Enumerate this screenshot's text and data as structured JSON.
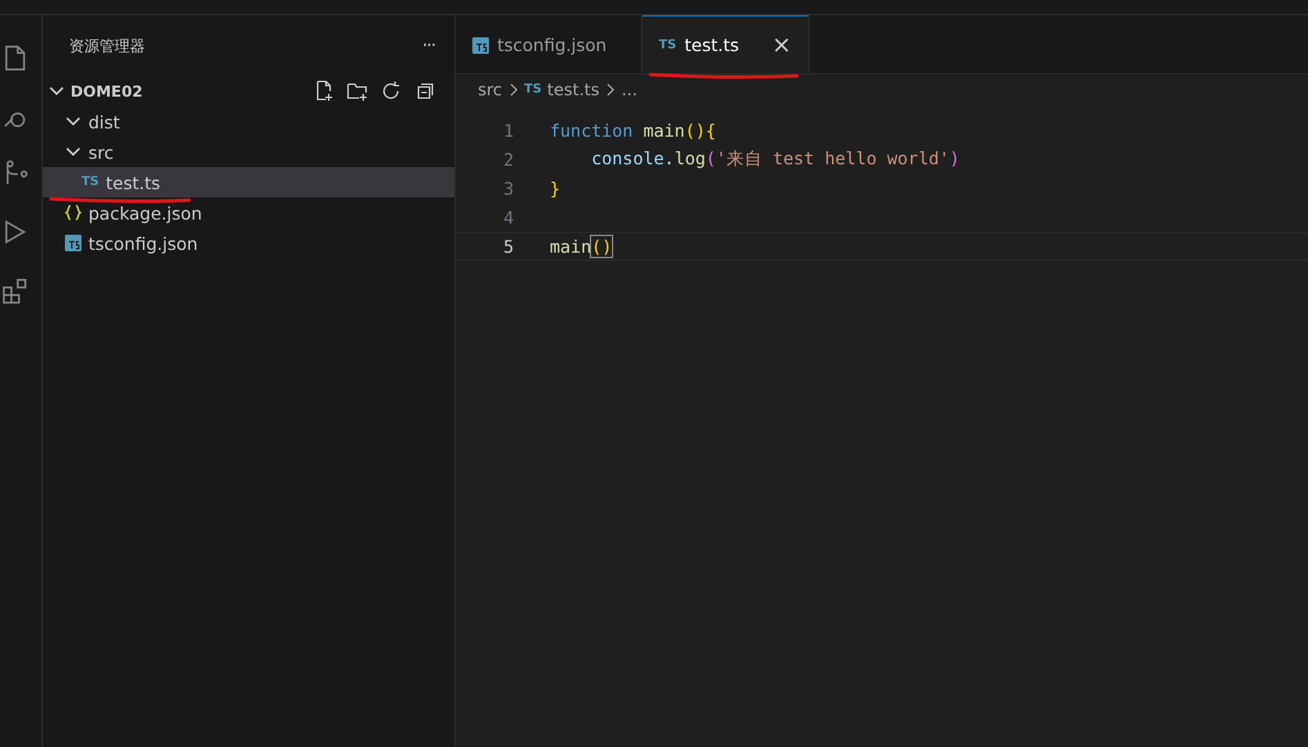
{
  "explorer": {
    "title": "资源管理器",
    "more": "···",
    "root": {
      "label": "DOME02",
      "expanded": true
    },
    "tree": [
      {
        "label": "dist",
        "kind": "folder",
        "expanded": true,
        "selected": false,
        "annotated": false
      },
      {
        "label": "src",
        "kind": "folder",
        "expanded": true,
        "selected": false,
        "annotated": false,
        "children": [
          {
            "label": "test.ts",
            "kind": "ts",
            "icon": "TS",
            "selected": true,
            "annotated": true
          }
        ]
      },
      {
        "label": "package.json",
        "kind": "json",
        "selected": false,
        "annotated": false
      },
      {
        "label": "tsconfig.json",
        "kind": "tsconfig",
        "selected": false,
        "annotated": false
      }
    ]
  },
  "tabs": [
    {
      "label": "tsconfig.json",
      "kind": "tsconfig",
      "selected": false,
      "annotated": false
    },
    {
      "label": "test.ts",
      "kind": "ts",
      "icon": "TS",
      "selected": true,
      "annotated": true,
      "close": "×"
    }
  ],
  "breadcrumbs": [
    {
      "label": "src",
      "kind": "folder"
    },
    {
      "label": "test.ts",
      "kind": "ts",
      "icon": "TS"
    },
    {
      "label": "...",
      "kind": "more"
    }
  ],
  "code": [
    {
      "number": "1",
      "current": false,
      "tokens": [
        {
          "text": "function",
          "kind": "keyword"
        },
        {
          "text": "main",
          "kind": "func"
        },
        {
          "text": "(){",
          "kind": "bracket"
        }
      ]
    },
    {
      "number": "2",
      "current": false,
      "indented": true,
      "tokens": [
        {
          "text": "console",
          "kind": "var"
        },
        {
          "text": ".",
          "kind": "plain"
        },
        {
          "text": "log",
          "kind": "func"
        },
        {
          "text": "(",
          "kind": "bracket2"
        },
        {
          "text": "'来自 test hello world'",
          "kind": "string"
        },
        {
          "text": ")",
          "kind": "bracket2"
        }
      ]
    },
    {
      "number": "3",
      "current": false,
      "tokens": [
        {
          "text": "}",
          "kind": "bracket"
        }
      ]
    },
    {
      "number": "4",
      "current": false
    },
    {
      "number": "5",
      "current": true,
      "tokens": [
        {
          "text": "main",
          "kind": "func"
        },
        {
          "text": "()",
          "kind": "bracketmatch"
        }
      ]
    }
  ]
}
